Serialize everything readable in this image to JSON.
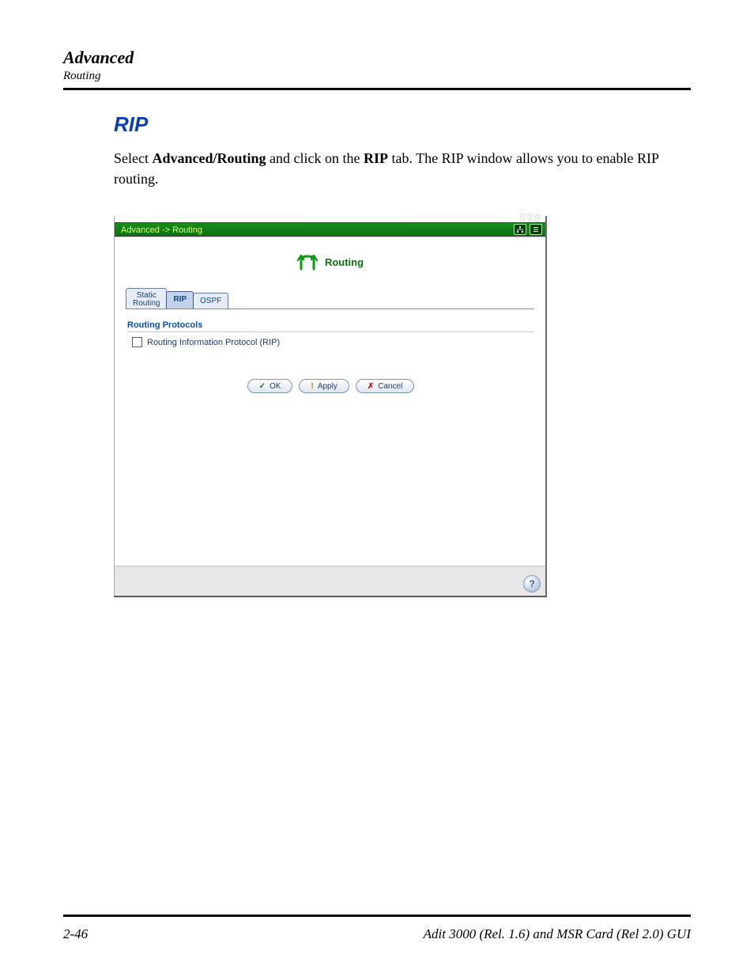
{
  "header": {
    "title": "Advanced",
    "subtitle": "Routing"
  },
  "section": {
    "heading": "RIP",
    "paragraph_pre": "Select ",
    "paragraph_b1": "Advanced/Routing",
    "paragraph_mid": " and click on the ",
    "paragraph_b2": "RIP",
    "paragraph_post": " tab.  The RIP window allows you to enable RIP routing."
  },
  "app": {
    "breadcrumb": "Advanced -> Routing",
    "panel_title": "Routing",
    "tabs": {
      "static_line1": "Static",
      "static_line2": "Routing",
      "rip": "RIP",
      "ospf": "OSPF"
    },
    "subheading": "Routing Protocols",
    "checkbox_label": "Routing Information Protocol (RIP)",
    "buttons": {
      "ok": "OK",
      "apply": "Apply",
      "cancel": "Cancel"
    },
    "help_glyph": "?"
  },
  "footer": {
    "left": "2-46",
    "right": "Adit 3000 (Rel. 1.6) and MSR Card (Rel 2.0) GUI"
  }
}
